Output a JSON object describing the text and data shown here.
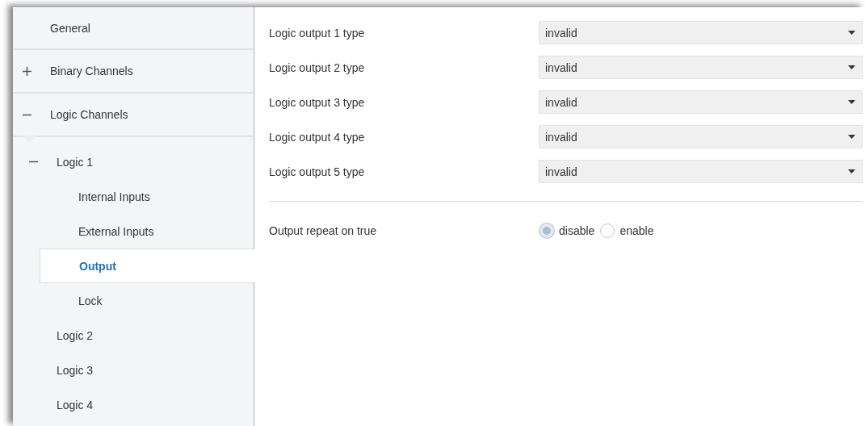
{
  "sidebar": {
    "items": [
      {
        "label": "General",
        "selected": false
      },
      {
        "label": "Binary Channels",
        "selected": false,
        "expanded": false
      },
      {
        "label": "Logic Channels",
        "selected": false,
        "expanded": true,
        "children": [
          {
            "label": "Logic 1",
            "selected": false,
            "expanded": true,
            "children": [
              {
                "label": "Internal Inputs",
                "selected": false
              },
              {
                "label": "External Inputs",
                "selected": false
              },
              {
                "label": "Output",
                "selected": true
              },
              {
                "label": "Lock",
                "selected": false
              }
            ]
          },
          {
            "label": "Logic 2",
            "selected": false
          },
          {
            "label": "Logic 3",
            "selected": false
          },
          {
            "label": "Logic 4",
            "selected": false
          }
        ]
      }
    ]
  },
  "parameters": [
    {
      "kind": "dropdown",
      "label": "Logic output 1 type",
      "value": "invalid"
    },
    {
      "kind": "dropdown",
      "label": "Logic output 2 type",
      "value": "invalid"
    },
    {
      "kind": "dropdown",
      "label": "Logic output 3 type",
      "value": "invalid"
    },
    {
      "kind": "dropdown",
      "label": "Logic output 4 type",
      "value": "invalid"
    },
    {
      "kind": "dropdown",
      "label": "Logic output 5 type",
      "value": "invalid"
    },
    {
      "kind": "divider"
    },
    {
      "kind": "radio",
      "label": "Output repeat on true",
      "options": [
        {
          "label": "disable",
          "selected": true
        },
        {
          "label": "enable",
          "selected": false
        }
      ]
    }
  ]
}
